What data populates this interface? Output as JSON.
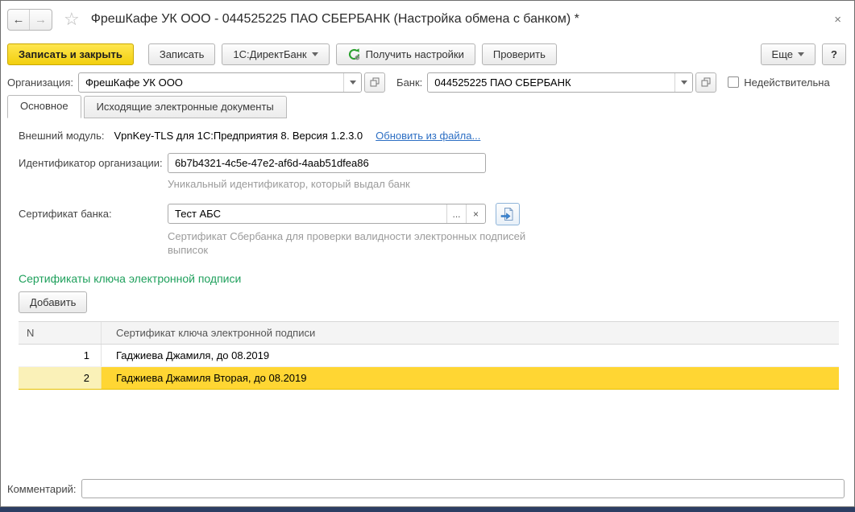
{
  "window": {
    "title": "ФрешКафе УК ООО - 044525225 ПАО СБЕРБАНК (Настройка обмена с банком) *",
    "close_label": "×"
  },
  "toolbar": {
    "save_close_label": "Записать и закрыть",
    "save_label": "Записать",
    "directbank_label": "1С:ДиректБанк",
    "get_settings_label": "Получить настройки",
    "check_label": "Проверить",
    "more_label": "Еще",
    "help_label": "?"
  },
  "fields": {
    "organization": {
      "label": "Организация:",
      "value": "ФрешКафе УК ООО"
    },
    "bank": {
      "label": "Банк:",
      "value": "044525225 ПАО СБЕРБАНК"
    },
    "invalid": {
      "label": "Недействительна",
      "checked": false
    }
  },
  "tabs": [
    {
      "label": "Основное",
      "active": true
    },
    {
      "label": "Исходящие электронные документы",
      "active": false
    }
  ],
  "main": {
    "external_module": {
      "label": "Внешний модуль:",
      "value": "VpnKey-TLS для 1С:Предприятия 8. Версия 1.2.3.0",
      "update_link_label": "Обновить из файла..."
    },
    "org_id": {
      "label": "Идентификатор организации:",
      "value": "6b7b4321-4c5e-47e2-af6d-4aab51dfea86",
      "hint": "Уникальный идентификатор, который выдал банк"
    },
    "bank_cert": {
      "label": "Сертификат банка:",
      "value": "Тест АБС",
      "ellipsis_label": "...",
      "clear_label": "×",
      "hint": "Сертификат Сбербанка для проверки валидности электронных подписей выписок"
    },
    "certs_section": {
      "title": "Сертификаты ключа электронной подписи",
      "add_button_label": "Добавить",
      "table": {
        "columns": [
          "N",
          "Сертификат ключа электронной подписи"
        ],
        "rows": [
          {
            "n": "1",
            "cert": "Гаджиева Джамиля, до 08.2019",
            "selected": false
          },
          {
            "n": "2",
            "cert": "Гаджиева Джамиля Вторая, до 08.2019",
            "selected": true
          }
        ]
      }
    }
  },
  "footer": {
    "comment_label": "Комментарий:",
    "comment_value": ""
  },
  "colors": {
    "primary_button": "#f2cf0e",
    "selected_row": "#ffd633",
    "selected_row_number": "#faf1b8",
    "section_title": "#1fa05c",
    "link": "#2d6fc4",
    "window_edge": "#2c3e63"
  }
}
